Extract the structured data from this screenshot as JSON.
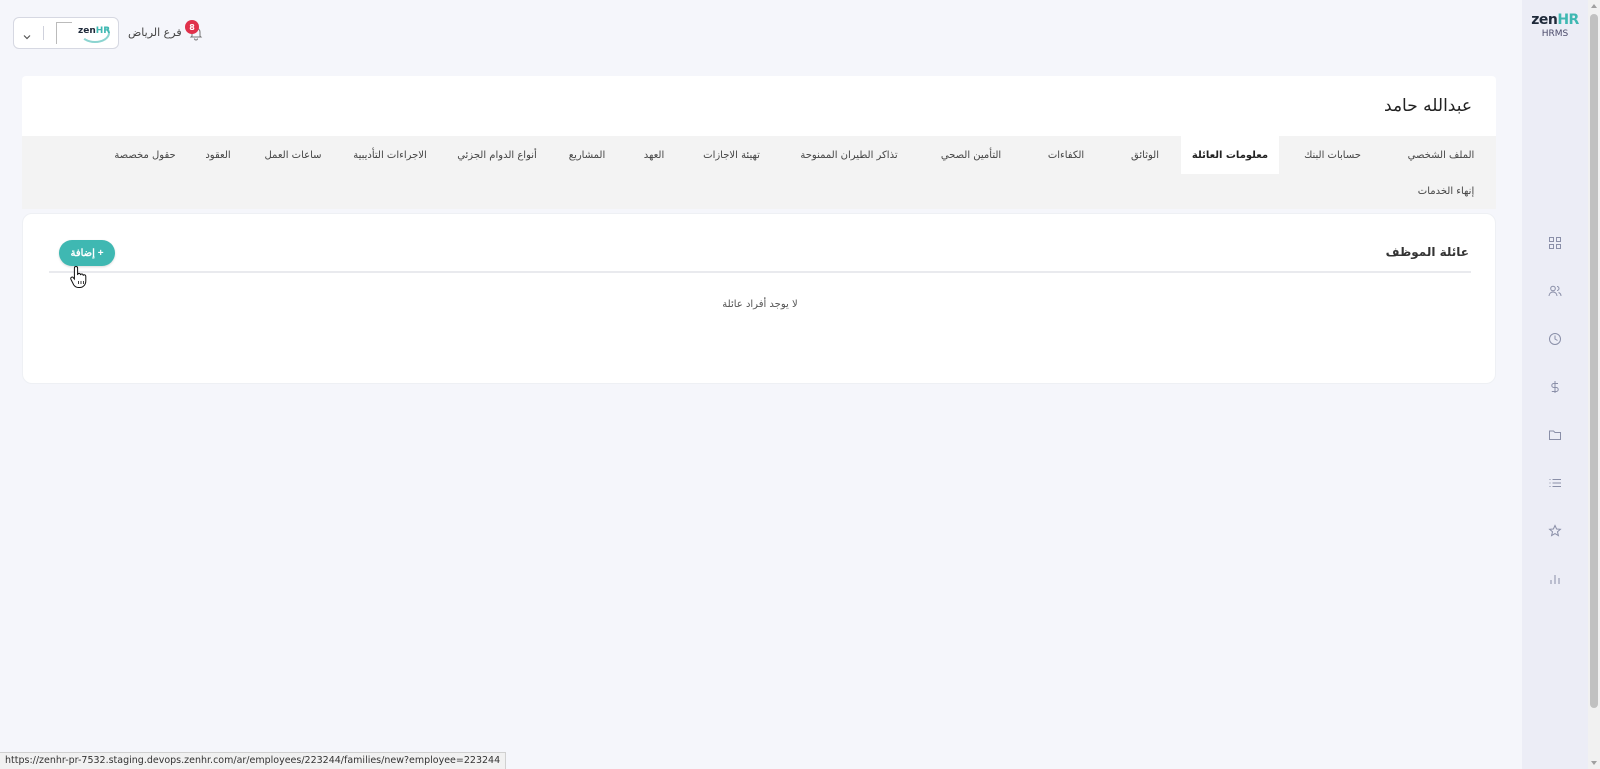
{
  "brand": {
    "logo_zen": "zen",
    "logo_hr": "HR",
    "logo_sub": "HRMS"
  },
  "header": {
    "company_select": {
      "mini_logo_zen": "zen",
      "mini_logo_hr": "HR"
    },
    "branch_label": "فرع الرياض",
    "notifications_count": "8"
  },
  "employee": {
    "name": "عبدالله حامد"
  },
  "tabs": [
    {
      "label": "الملف الشخصي"
    },
    {
      "label": "حسابات البنك"
    },
    {
      "label": "معلومات العائلة"
    },
    {
      "label": "الوثائق"
    },
    {
      "label": "الكفاءات"
    },
    {
      "label": "التأمين الصحي"
    },
    {
      "label": "تذاكر الطيران الممنوحة"
    },
    {
      "label": "تهيئة الاجازات"
    },
    {
      "label": "العهد"
    },
    {
      "label": "المشاريع"
    },
    {
      "label": "أنواع الدوام الجزئي"
    },
    {
      "label": "الاجراءات التأديبية"
    },
    {
      "label": "ساعات العمل"
    },
    {
      "label": "العقود"
    },
    {
      "label": "حقول مخصصة"
    },
    {
      "label": "إنهاء الخدمات"
    }
  ],
  "active_tab": "معلومات العائلة",
  "family_section": {
    "title": "عائلة الموظف",
    "add_button": "+ إضافة",
    "empty_message": "لا يوجد أفراد عائلة"
  },
  "sidebar_icons": [
    "dashboard-icon",
    "people-icon",
    "clock-icon",
    "dollar-icon",
    "folder-icon",
    "list-icon",
    "star-icon",
    "bar-chart-icon"
  ],
  "status_bar": {
    "url": "https://zenhr-pr-7532.staging.devops.zenhr.com/ar/employees/223244/families/new?employee=223244"
  },
  "colors": {
    "accent": "#3fb8b2",
    "badge": "#e0314b",
    "sidebar_bg": "#ecedf6",
    "page_bg": "#f5f6fb"
  }
}
